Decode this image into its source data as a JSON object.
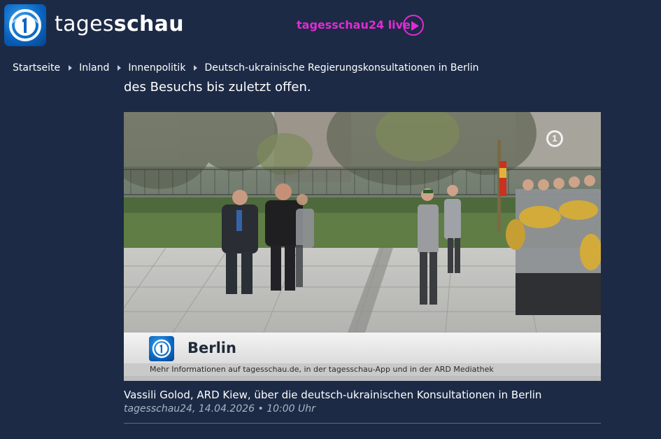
{
  "header": {
    "brand_light": "tages",
    "brand_bold": "schau",
    "live_link": "tagesschau24 live",
    "logo_icon": "ard-one-logo-icon",
    "play_icon": "play-circle-icon",
    "accent_color": "#e32ad4",
    "background_color": "#1c2a45"
  },
  "breadcrumb": {
    "items": [
      {
        "label": "Startseite"
      },
      {
        "label": "Inland"
      },
      {
        "label": "Innenpolitik"
      },
      {
        "label": "Deutsch-ukrainische Regierungskonsultationen in Berlin"
      }
    ],
    "separator_icon": "triangle-right-icon"
  },
  "article": {
    "lead_text": "des Besuchs bis zuletzt offen."
  },
  "video": {
    "lower_third_title": "Berlin",
    "info_text": "Mehr Informationen auf tagesschau.de, in der tagesschau-App und in der ARD Mediathek",
    "channel_bug": "1",
    "caption": "Vassili Golod, ARD Kiew, über die deutsch-ukrainischen Konsultationen in Berlin",
    "meta": "tagesschau24, 14.04.2026 • 10:00 Uhr"
  }
}
